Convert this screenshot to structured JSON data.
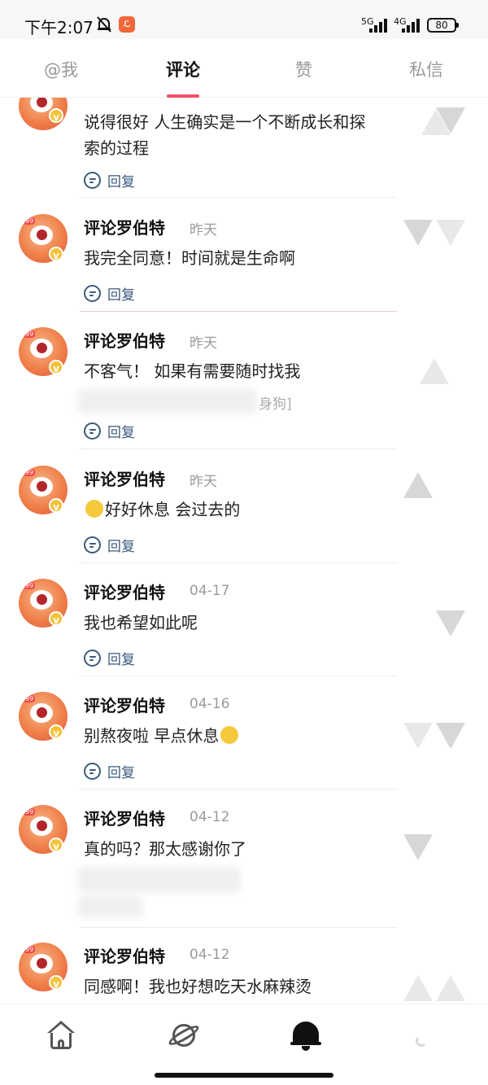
{
  "status_bar": {
    "time": "下午2:07",
    "app_badge": "ℒ",
    "net1": "5G",
    "net2": "4G",
    "battery": "80"
  },
  "tabs": [
    {
      "label": "@我",
      "active": false
    },
    {
      "label": "评论",
      "active": true
    },
    {
      "label": "赞",
      "active": false
    },
    {
      "label": "私信",
      "active": false
    }
  ],
  "comments": [
    {
      "name": "",
      "date": "",
      "text_line1": "说得很好 人生确实是一个不断成长和探",
      "text_line2": "索的过程",
      "reply_label": "回复"
    },
    {
      "name": "评论罗伯特",
      "date": "昨天",
      "text": "我完全同意！时间就是生命啊",
      "reply_label": "回复"
    },
    {
      "name": "评论罗伯特",
      "date": "昨天",
      "text": "不客气！ 如果有需要随时找我",
      "quote_fragment": "身狗]",
      "reply_label": "回复"
    },
    {
      "name": "评论罗伯特",
      "date": "昨天",
      "text": "好好休息 会过去的",
      "reply_label": "回复"
    },
    {
      "name": "评论罗伯特",
      "date": "04-17",
      "text": "我也希望如此呢",
      "reply_label": "回复"
    },
    {
      "name": "评论罗伯特",
      "date": "04-16",
      "text": "别熬夜啦 早点休息",
      "reply_label": "回复"
    },
    {
      "name": "评论罗伯特",
      "date": "04-12",
      "text": "真的吗？那太感谢你了",
      "reply_label": "回复"
    },
    {
      "name": "评论罗伯特",
      "date": "04-12",
      "text": "同感啊！我也好想吃天水麻辣烫",
      "reply_label": ""
    }
  ],
  "bottom_nav": [
    {
      "icon": "home-icon"
    },
    {
      "icon": "planet-icon"
    },
    {
      "icon": "bell-icon",
      "active": true
    },
    {
      "icon": "profile-icon"
    }
  ],
  "colors": {
    "accent": "#f04f67",
    "reply": "#3b5a7d",
    "verified_badge": "#f4c33a"
  }
}
